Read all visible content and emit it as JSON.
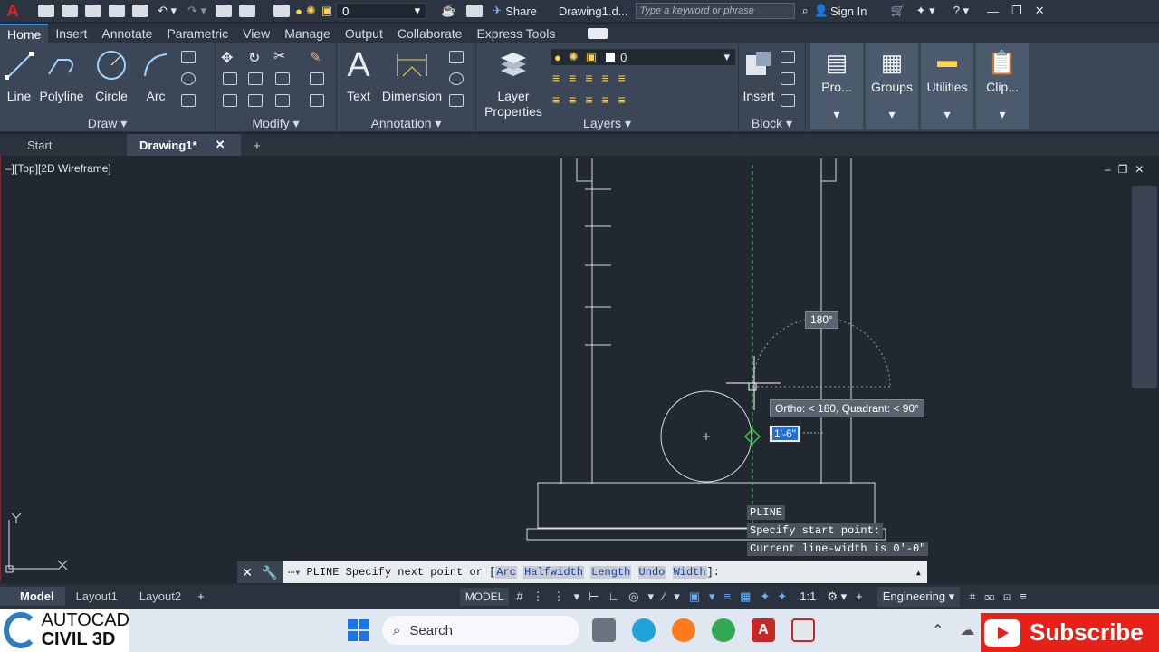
{
  "qat": {
    "layer_value": "0",
    "share_label": "Share",
    "doc_title": "Drawing1.d...",
    "search_placeholder": "Type a keyword or phrase",
    "sign_in": "Sign In"
  },
  "ribbon_tabs": [
    "Home",
    "Insert",
    "Annotate",
    "Parametric",
    "View",
    "Manage",
    "Output",
    "Collaborate",
    "Express Tools"
  ],
  "draw": {
    "line": "Line",
    "polyline": "Polyline",
    "circle": "Circle",
    "arc": "Arc",
    "title": "Draw ▾"
  },
  "modify": {
    "title": "Modify ▾"
  },
  "annotation": {
    "text": "Text",
    "dimension": "Dimension",
    "title": "Annotation ▾"
  },
  "layers": {
    "layer_properties": "Layer\nProperties",
    "current": "0",
    "title": "Layers ▾"
  },
  "block": {
    "insert": "Insert",
    "title": "Block ▾"
  },
  "extra_panels": {
    "properties": "Pro...",
    "groups": "Groups",
    "utilities": "Utilities",
    "clipboard": "Clip..."
  },
  "file_tabs": {
    "start": "Start",
    "drawing": "Drawing1*"
  },
  "viewport_label": "–][Top][2D Wireframe]",
  "tooltips": {
    "angle": "180°",
    "ortho": "Ortho: < 180, Quadrant: < 90°",
    "distance": "1'-6\""
  },
  "command_history": [
    "PLINE",
    "Specify start point:",
    "Current line-width is 0'-0\""
  ],
  "command_line": {
    "prefix": "PLINE Specify next point or [",
    "options": [
      "Arc",
      "Halfwidth",
      "Length",
      "Undo",
      "Width"
    ],
    "suffix": "]:"
  },
  "layout_tabs": [
    "Model",
    "Layout1",
    "Layout2"
  ],
  "status": {
    "model": "MODEL",
    "scale": "1:1",
    "workspace": "Engineering"
  },
  "taskbar": {
    "search": "Search"
  },
  "brand": {
    "line1": "AUTOCAD",
    "line2": "CIVIL 3D"
  },
  "subscribe": "Subscribe",
  "colors": {
    "accent": "#2f8cff",
    "subscribe": "#e62117",
    "drawing_bg": "#212830",
    "ucs": "#d9dee5"
  }
}
